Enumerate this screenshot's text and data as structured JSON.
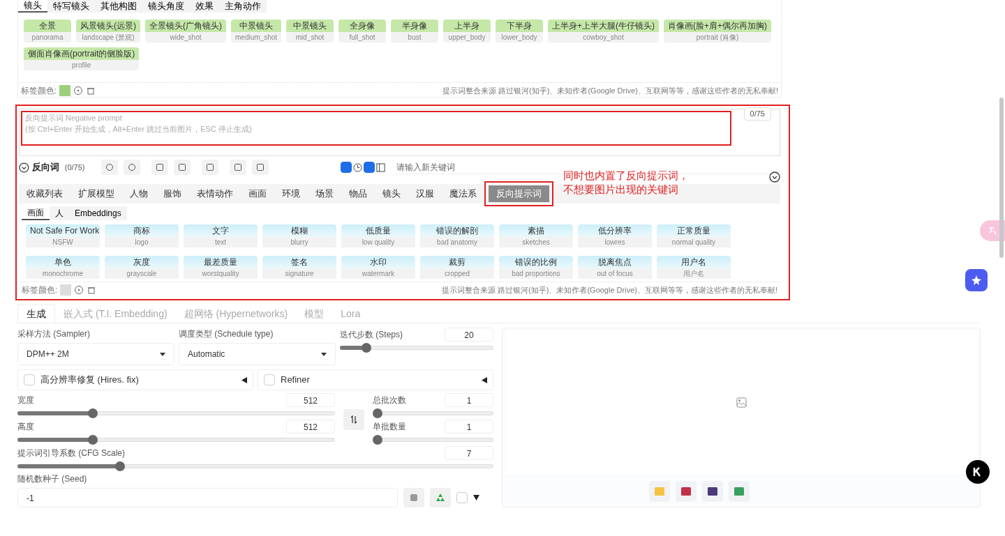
{
  "top_panel": {
    "tabs": [
      {
        "label": "镜头",
        "selected": true
      },
      {
        "label": "特写镜头",
        "selected": false
      },
      {
        "label": "其他构图",
        "selected": false
      },
      {
        "label": "镜头角度",
        "selected": false
      },
      {
        "label": "效果",
        "selected": false
      },
      {
        "label": "主角动作",
        "selected": false
      }
    ],
    "tags": [
      {
        "label": "全景",
        "sub": "panorama"
      },
      {
        "label": "风景镜头(远景)",
        "sub": "landscape (景观)"
      },
      {
        "label": "全景镜头(广角镜头)",
        "sub": "wide_shot"
      },
      {
        "label": "中景镜头",
        "sub": "medium_shot"
      },
      {
        "label": "中景镜头",
        "sub": "mid_shot"
      },
      {
        "label": "全身像",
        "sub": "full_shot"
      },
      {
        "label": "半身像",
        "sub": "bust"
      },
      {
        "label": "上半身",
        "sub": "upper_body"
      },
      {
        "label": "下半身",
        "sub": "lower_body"
      },
      {
        "label": "上半身+上半大腿(牛仔镜头)",
        "sub": "cowboy_shot"
      },
      {
        "label": "肖像画(脸+肩+偶尔再加胸)",
        "sub": "portrait (肖像)"
      },
      {
        "label": "侧面肖像画(portrait的侧脸版)",
        "sub": "profile"
      }
    ],
    "color_label": "标签颜色:",
    "credits": "提示词整合来源 路过银河(知乎)、未知作者(Google Drive)、互联网等等，感谢这些作者的无私奉献!"
  },
  "negative_prompt": {
    "counter": "0/75",
    "placeholder": "反向提示词 Negative prompt\n(按 Ctrl+Enter 开始生成，Alt+Enter 跳过当前图片，ESC 停止生成)",
    "title": "反向词",
    "title_count": "(0/75)",
    "toggle_a": true,
    "toggle_b": true,
    "keyword_placeholder": "请输入新关键词",
    "tabs": [
      {
        "label": "收藏列表",
        "selected": false
      },
      {
        "label": "扩展模型",
        "selected": false
      },
      {
        "label": "人物",
        "selected": false
      },
      {
        "label": "服饰",
        "selected": false
      },
      {
        "label": "表情动作",
        "selected": false
      },
      {
        "label": "画面",
        "selected": false
      },
      {
        "label": "环境",
        "selected": false
      },
      {
        "label": "场景",
        "selected": false
      },
      {
        "label": "物品",
        "selected": false
      },
      {
        "label": "镜头",
        "selected": false
      },
      {
        "label": "汉服",
        "selected": false
      },
      {
        "label": "魔法系",
        "selected": false
      },
      {
        "label": "反向提示词",
        "selected": true
      }
    ],
    "subtabs": [
      {
        "label": "画面",
        "selected": true
      },
      {
        "label": "人",
        "selected": false
      },
      {
        "label": "Embeddings",
        "selected": false
      }
    ],
    "tags": [
      {
        "label": "Not Safe For Work",
        "sub": "NSFW"
      },
      {
        "label": "商标",
        "sub": "logo"
      },
      {
        "label": "文字",
        "sub": "text"
      },
      {
        "label": "模糊",
        "sub": "blurry"
      },
      {
        "label": "低质量",
        "sub": "low quality"
      },
      {
        "label": "错误的解剖",
        "sub": "bad anatomy"
      },
      {
        "label": "素描",
        "sub": "sketches"
      },
      {
        "label": "低分辨率",
        "sub": "lowres"
      },
      {
        "label": "正常质量",
        "sub": "normal quality"
      },
      {
        "label": "单色",
        "sub": "monochrome"
      },
      {
        "label": "灰度",
        "sub": "grayscale"
      },
      {
        "label": "最差质量",
        "sub": "worstquality"
      },
      {
        "label": "签名",
        "sub": "signature"
      },
      {
        "label": "水印",
        "sub": "watermark"
      },
      {
        "label": "裁剪",
        "sub": "cropped"
      },
      {
        "label": "错误的比例",
        "sub": "bad proportions"
      },
      {
        "label": "脱离焦点",
        "sub": "out of focus"
      },
      {
        "label": "用户名",
        "sub": "用户名"
      }
    ],
    "color_label": "标签颜色:",
    "credits": "提示词整合来源 路过银河(知乎)、未知作者(Google Drive)、互联网等等，感谢这些作者的无私奉献!",
    "annotation": [
      "同时也内置了反向提示词，",
      "不想要图片出现的关键词"
    ]
  },
  "main_tabs": [
    {
      "label": "生成",
      "selected": true
    },
    {
      "label": "嵌入式 (T.I. Embedding)",
      "selected": false
    },
    {
      "label": "超网络 (Hypernetworks)",
      "selected": false
    },
    {
      "label": "模型",
      "selected": false
    },
    {
      "label": "Lora",
      "selected": false
    }
  ],
  "settings": {
    "sampler": {
      "label": "采样方法 (Sampler)",
      "value": "DPM++ 2M"
    },
    "schedule": {
      "label": "调度类型 (Schedule type)",
      "value": "Automatic"
    },
    "steps": {
      "label": "迭代步数 (Steps)",
      "value": "20",
      "level": 0.15
    },
    "hires": {
      "label": "高分辨率修复 (Hires. fix)",
      "checked": false
    },
    "refiner": {
      "label": "Refiner",
      "checked": false
    },
    "width": {
      "label": "宽度",
      "value": "512",
      "level": 0.23
    },
    "height": {
      "label": "高度",
      "value": "512",
      "level": 0.23
    },
    "batch_count": {
      "label": "总批次数",
      "value": "1",
      "level": 0
    },
    "batch_size": {
      "label": "单批数量",
      "value": "1",
      "level": 0
    },
    "cfg": {
      "label": "提示词引导系数 (CFG Scale)",
      "value": "7",
      "level": 0.21
    },
    "seed": {
      "label": "随机数种子 (Seed)",
      "value": "-1",
      "extra_checked": false
    }
  }
}
